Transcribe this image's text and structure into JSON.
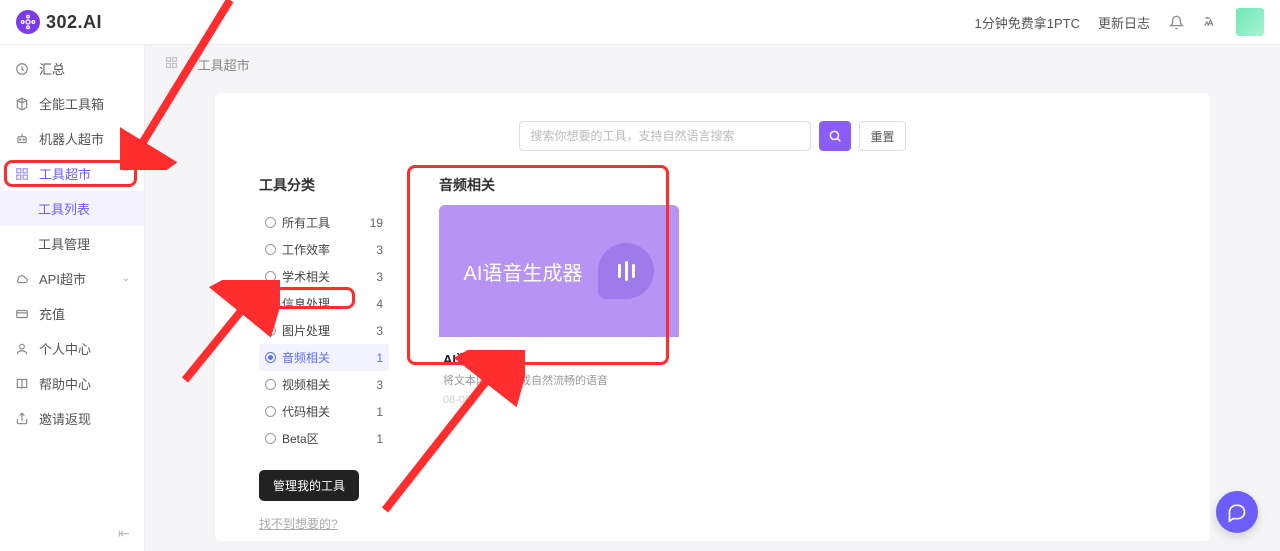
{
  "header": {
    "brand": "302.AI",
    "promo": "1分钟免费拿1PTC",
    "changelog": "更新日志"
  },
  "sidebar": {
    "items": [
      {
        "label": "汇总"
      },
      {
        "label": "全能工具箱"
      },
      {
        "label": "机器人超市",
        "chev": "⌄"
      },
      {
        "label": "工具超市",
        "chev": "⌃",
        "active": true
      },
      {
        "label": "工具列表",
        "sub": true,
        "selected": true
      },
      {
        "label": "工具管理",
        "sub": true
      },
      {
        "label": "API超市",
        "chev": "⌄"
      },
      {
        "label": "充值"
      },
      {
        "label": "个人中心"
      },
      {
        "label": "帮助中心"
      },
      {
        "label": "邀请返现"
      }
    ]
  },
  "breadcrumb": {
    "a": "工具超市"
  },
  "search": {
    "placeholder": "搜索你想要的工具，支持自然语言搜索",
    "reset": "重置"
  },
  "categories": {
    "title": "工具分类",
    "items": [
      {
        "label": "所有工具",
        "count": "19"
      },
      {
        "label": "工作效率",
        "count": "3"
      },
      {
        "label": "学术相关",
        "count": "3"
      },
      {
        "label": "信息处理",
        "count": "4"
      },
      {
        "label": "图片处理",
        "count": "3"
      },
      {
        "label": "音频相关",
        "count": "1",
        "selected": true
      },
      {
        "label": "视频相关",
        "count": "3"
      },
      {
        "label": "代码相关",
        "count": "1"
      },
      {
        "label": "Beta区",
        "count": "1"
      }
    ],
    "manage": "管理我的工具",
    "notfound": "找不到想要的?"
  },
  "tools": {
    "section": "音频相关",
    "card": {
      "thumb_text": "AI语音生成器",
      "name": "AI语音生成器",
      "desc": "将文本内容转换成自然流畅的语音",
      "date": "08-08"
    }
  }
}
